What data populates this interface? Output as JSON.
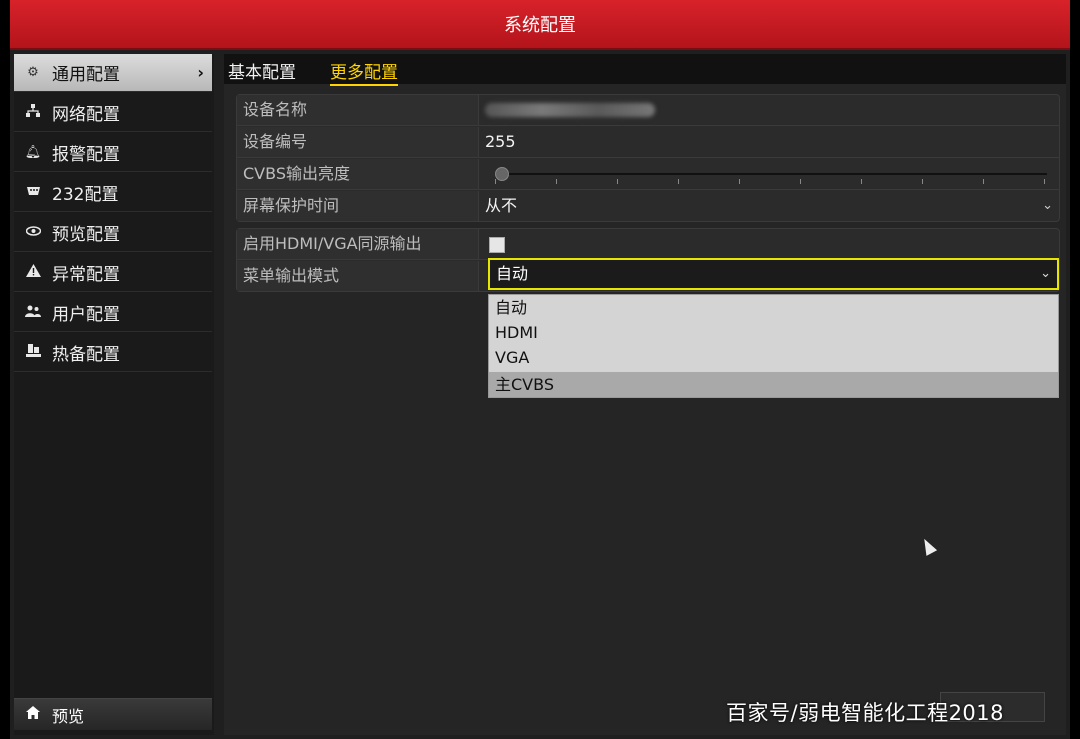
{
  "window": {
    "title": "系统配置"
  },
  "sidebar": {
    "items": [
      {
        "label": "通用配置",
        "icon": "gear-icon",
        "active": true
      },
      {
        "label": "网络配置",
        "icon": "network-icon"
      },
      {
        "label": "报警配置",
        "icon": "alarm-bell-icon"
      },
      {
        "label": "232配置",
        "icon": "serial-port-icon"
      },
      {
        "label": "预览配置",
        "icon": "eye-icon"
      },
      {
        "label": "异常配置",
        "icon": "warning-icon"
      },
      {
        "label": "用户配置",
        "icon": "users-icon"
      },
      {
        "label": "热备配置",
        "icon": "hot-spare-icon"
      }
    ],
    "bottom": {
      "label": "预览",
      "icon": "home-icon"
    }
  },
  "tabs": [
    {
      "label": "基本配置",
      "active": false
    },
    {
      "label": "更多配置",
      "active": true
    }
  ],
  "form": {
    "device_name": {
      "label": "设备名称",
      "value": ""
    },
    "device_number": {
      "label": "设备编号",
      "value": "255"
    },
    "cvbs_brightness": {
      "label": "CVBS输出亮度",
      "level": 0.0
    },
    "screen_saver": {
      "label": "屏幕保护时间",
      "value": "从不"
    },
    "hdmi_vga_same_source": {
      "label": "启用HDMI/VGA同源输出",
      "checked": false
    },
    "menu_output_mode": {
      "label": "菜单输出模式",
      "value": "自动",
      "options": [
        "自动",
        "HDMI",
        "VGA",
        "主CVBS"
      ],
      "highlighted": "主CVBS"
    }
  },
  "watermark": "百家号/弱电智能化工程2018",
  "colors": {
    "title_bar": "#c8191f",
    "tab_active": "#ffd400",
    "focus_border": "#e6e600"
  }
}
